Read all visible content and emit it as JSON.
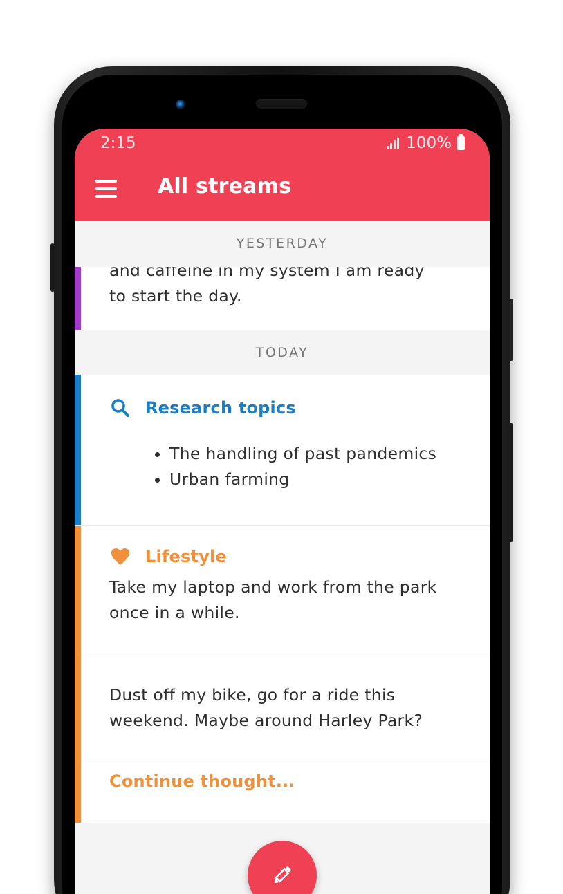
{
  "status_bar": {
    "time": "2:15",
    "battery": "100%"
  },
  "app_bar": {
    "title": "All streams",
    "menu_icon": "hamburger-menu-icon"
  },
  "sections": {
    "yesterday": "YESTERDAY",
    "today": "TODAY"
  },
  "entries": {
    "yesterday_note": {
      "text": "and caffeine in my system I am ready to start the day.",
      "accent": "#a23dc8"
    },
    "research": {
      "title": "Research topics",
      "icon": "search-icon",
      "color": "#1a7fc4",
      "items": [
        "The handling of past pandemics",
        "Urban farming"
      ]
    },
    "lifestyle": {
      "title": "Lifestyle",
      "icon": "heart-icon",
      "color": "#f0903a",
      "note1": "Take my laptop and work from the park once in a while.",
      "note2": "Dust off my bike, go for a ride this weekend. Maybe around Harley Park?",
      "continue": "Continue thought..."
    }
  },
  "fab": {
    "icon": "pencil-icon",
    "color": "#ef4054"
  },
  "colors": {
    "brand": "#ef4054",
    "background": "#f4f4f4"
  }
}
